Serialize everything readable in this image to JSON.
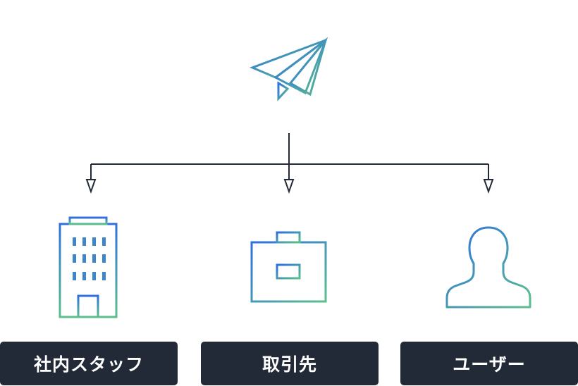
{
  "colors": {
    "gradient_start": "#2f6fe0",
    "gradient_end": "#5bc08c",
    "connector": "#222a38",
    "label_bg": "#222a38",
    "label_text": "#ffffff"
  },
  "source": {
    "icon": "paper-plane-icon"
  },
  "targets": [
    {
      "label": "社内スタッフ",
      "icon": "office-building-icon"
    },
    {
      "label": "取引先",
      "icon": "briefcase-icon"
    },
    {
      "label": "ユーザー",
      "icon": "user-silhouette-icon"
    }
  ]
}
